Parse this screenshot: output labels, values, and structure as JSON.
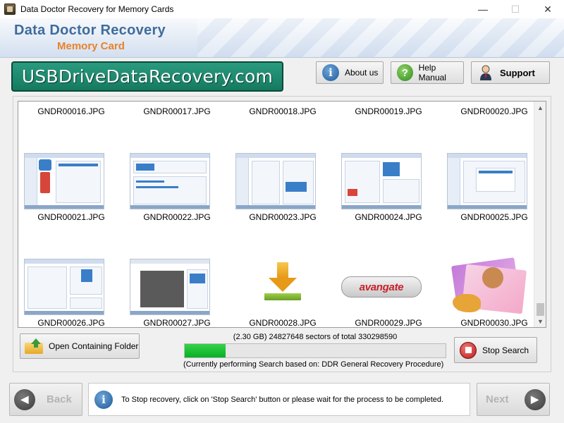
{
  "window": {
    "title": "Data Doctor Recovery for Memory Cards",
    "minimize": "—",
    "maximize": "☐",
    "close": "✕"
  },
  "header": {
    "brand": "Data Doctor Recovery",
    "product": "Memory Card"
  },
  "banner": {
    "text": "USBDriveDataRecovery.com"
  },
  "toolbar": {
    "about_label": "About us",
    "help_label": "Help Manual",
    "support_label": "Support"
  },
  "files": [
    "GNDR00016.JPG",
    "GNDR00017.JPG",
    "GNDR00018.JPG",
    "GNDR00019.JPG",
    "GNDR00020.JPG",
    "GNDR00021.JPG",
    "GNDR00022.JPG",
    "GNDR00023.JPG",
    "GNDR00024.JPG",
    "GNDR00025.JPG",
    "GNDR00026.JPG",
    "GNDR00027.JPG",
    "GNDR00028.JPG",
    "GNDR00029.JPG",
    "GNDR00030.JPG"
  ],
  "thumbnails": {
    "logo_text": "avangate"
  },
  "actions": {
    "open_folder_label": "Open Containing Folder",
    "stop_label": "Stop Search"
  },
  "progress": {
    "status_text": "(2.30 GB) 24827648  sectors  of  total 330298590",
    "fraction": 0.0752,
    "mode_text": "(Currently performing Search based on:  DDR General Recovery Procedure)"
  },
  "footer": {
    "back_label": "Back",
    "next_label": "Next",
    "info_text": "To Stop recovery, click on 'Stop Search' button or please wait for the process to be completed."
  },
  "colors": {
    "brand_blue": "#3f6c9c",
    "brand_orange": "#e8822b",
    "banner_green": "#147a60",
    "progress_green": "#06b025"
  }
}
